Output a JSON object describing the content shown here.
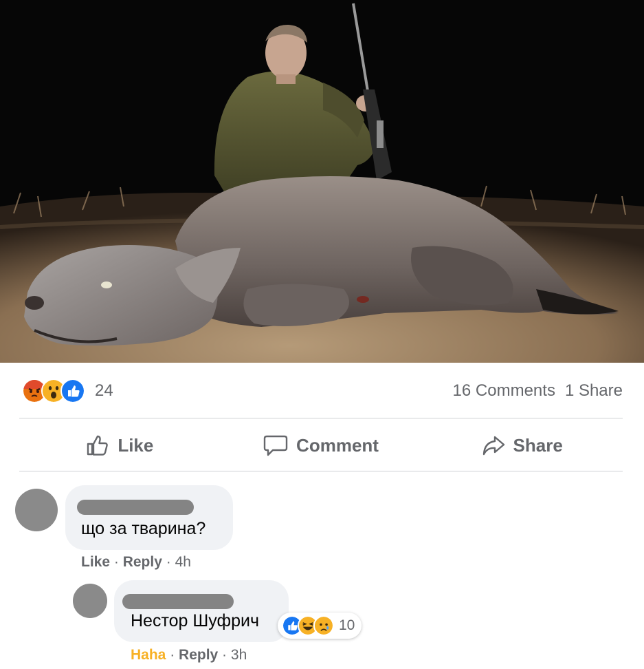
{
  "post": {
    "reactions": {
      "icons": [
        "angry-icon",
        "wow-icon",
        "like-icon"
      ],
      "count": "24"
    },
    "comments_count": "16 Comments",
    "shares_count": "1 Share"
  },
  "actions": {
    "like": "Like",
    "comment": "Comment",
    "share": "Share"
  },
  "comments": [
    {
      "text": "що за тварина?",
      "like": "Like",
      "reply": "Reply",
      "time": "4h"
    },
    {
      "text": "Нестор Шуфрич",
      "reaction_icons": [
        "like-icon",
        "haha-icon",
        "sad-icon"
      ],
      "reaction_count": "10",
      "reacted": "Haha",
      "reply": "Reply",
      "time": "3h"
    }
  ],
  "colors": {
    "meta_gray": "#65676b",
    "bubble": "#f0f2f5",
    "like_blue": "#1877f2",
    "haha_yellow": "#f7b125",
    "divider": "#ced0d4"
  }
}
